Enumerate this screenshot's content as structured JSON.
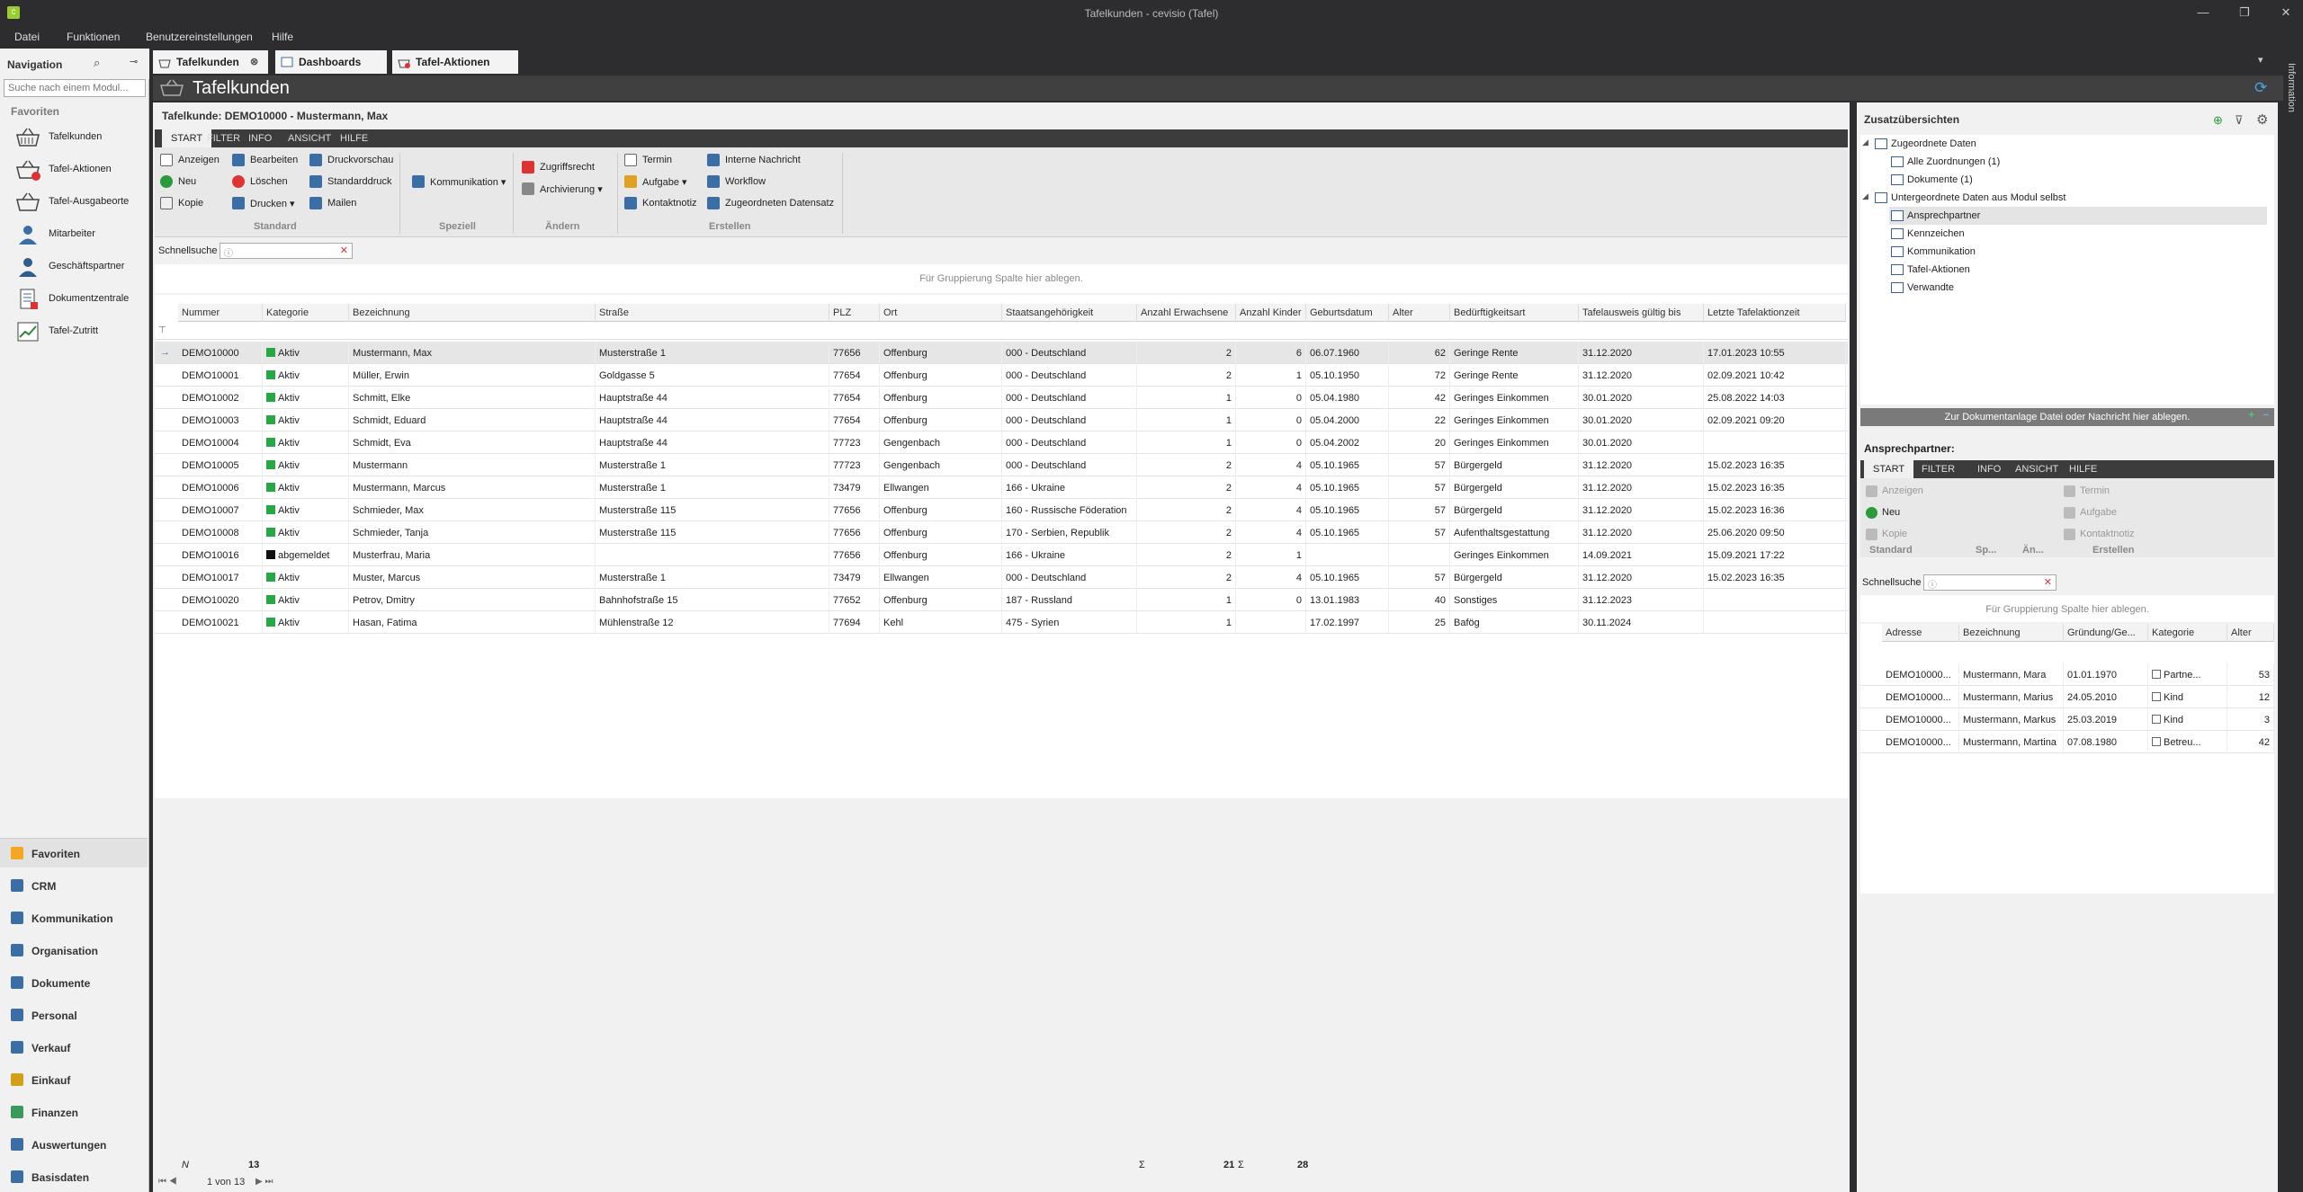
{
  "window": {
    "title": "Tafelkunden - cevisio (Tafel)"
  },
  "menu": [
    "Datei",
    "Funktionen",
    "Benutzereinstellungen",
    "Hilfe"
  ],
  "nav": {
    "title": "Navigation",
    "search_placeholder": "Suche nach einem Modul...",
    "favorites_header": "Favoriten",
    "items": [
      {
        "label": "Tafelkunden",
        "icon": "basket-icon"
      },
      {
        "label": "Tafel-Aktionen",
        "icon": "basket-action-icon"
      },
      {
        "label": "Tafel-Ausgabeorte",
        "icon": "basket-location-icon"
      },
      {
        "label": "Mitarbeiter",
        "icon": "employee-icon"
      },
      {
        "label": "Geschäftspartner",
        "icon": "partner-icon"
      },
      {
        "label": "Dokumentzentrale",
        "icon": "document-icon"
      },
      {
        "label": "Tafel-Zutritt",
        "icon": "chart-icon"
      }
    ],
    "categories": [
      {
        "label": "Favoriten",
        "color": "#f5a623"
      },
      {
        "label": "CRM",
        "color": "#3a6ea5"
      },
      {
        "label": "Kommunikation",
        "color": "#3a6ea5"
      },
      {
        "label": "Organisation",
        "color": "#3a6ea5"
      },
      {
        "label": "Dokumente",
        "color": "#3a6ea5"
      },
      {
        "label": "Personal",
        "color": "#3a6ea5"
      },
      {
        "label": "Verkauf",
        "color": "#3a6ea5"
      },
      {
        "label": "Einkauf",
        "color": "#d4a017"
      },
      {
        "label": "Finanzen",
        "color": "#3a9a5a"
      },
      {
        "label": "Auswertungen",
        "color": "#3a6ea5"
      },
      {
        "label": "Basisdaten",
        "color": "#3a6ea5"
      }
    ]
  },
  "doc_tabs": [
    "Tafelkunden",
    "Dashboards",
    "Tafel-Aktionen"
  ],
  "page": {
    "heading": "Tafelkunden",
    "record_title": "Tafelkunde: DEMO10000 - Mustermann, Max"
  },
  "ribbon": {
    "tabs": [
      "START",
      "FILTER",
      "INFO",
      "ANSICHT",
      "HILFE"
    ],
    "buttons": {
      "anzeigen": "Anzeigen",
      "neu": "Neu",
      "kopie": "Kopie",
      "bearbeiten": "Bearbeiten",
      "loeschen": "Löschen",
      "drucken": "Drucken",
      "druckvorschau": "Druckvorschau",
      "standarddruck": "Standarddruck",
      "mailen": "Mailen",
      "kommunikation": "Kommunikation",
      "zugriffsrecht": "Zugriffsrecht",
      "archivierung": "Archivierung",
      "termin": "Termin",
      "aufgabe": "Aufgabe",
      "kontaktnotiz": "Kontaktnotiz",
      "interne_nachricht": "Interne Nachricht",
      "workflow": "Workflow",
      "zugeordneten_datensatz": "Zugeordneten Datensatz"
    },
    "groups": [
      "Standard",
      "Speziell",
      "Ändern",
      "Erstellen"
    ]
  },
  "quicksearch": {
    "label": "Schnellsuche"
  },
  "group_hint": "Für Gruppierung Spalte hier ablegen.",
  "grid": {
    "columns": [
      "Nummer",
      "Kategorie",
      "Bezeichnung",
      "Straße",
      "PLZ",
      "Ort",
      "Staatsangehörigkeit",
      "Anzahl Erwachsene",
      "Anzahl Kinder",
      "Geburtsdatum",
      "Alter",
      "Bedürftigkeitsart",
      "Tafelausweis gültig bis",
      "Letzte Tafelaktionzeit"
    ],
    "rows": [
      [
        "DEMO10000",
        "Aktiv",
        "Mustermann, Max",
        "Musterstraße 1",
        "77656",
        "Offenburg",
        "000 - Deutschland",
        "2",
        "6",
        "06.07.1960",
        "62",
        "Geringe Rente",
        "31.12.2020",
        "17.01.2023 10:55"
      ],
      [
        "DEMO10001",
        "Aktiv",
        "Müller, Erwin",
        "Goldgasse 5",
        "77654",
        "Offenburg",
        "000 - Deutschland",
        "2",
        "1",
        "05.10.1950",
        "72",
        "Geringe Rente",
        "31.12.2020",
        "02.09.2021 10:42"
      ],
      [
        "DEMO10002",
        "Aktiv",
        "Schmitt, Elke",
        "Hauptstraße 44",
        "77654",
        "Offenburg",
        "000 - Deutschland",
        "1",
        "0",
        "05.04.1980",
        "42",
        "Geringes Einkommen",
        "30.01.2020",
        "25.08.2022 14:03"
      ],
      [
        "DEMO10003",
        "Aktiv",
        "Schmidt, Eduard",
        "Hauptstraße 44",
        "77654",
        "Offenburg",
        "000 - Deutschland",
        "1",
        "0",
        "05.04.2000",
        "22",
        "Geringes Einkommen",
        "30.01.2020",
        "02.09.2021 09:20"
      ],
      [
        "DEMO10004",
        "Aktiv",
        "Schmidt, Eva",
        "Hauptstraße 44",
        "77723",
        "Gengenbach",
        "000 - Deutschland",
        "1",
        "0",
        "05.04.2002",
        "20",
        "Geringes Einkommen",
        "30.01.2020",
        ""
      ],
      [
        "DEMO10005",
        "Aktiv",
        "Mustermann",
        "Musterstraße 1",
        "77723",
        "Gengenbach",
        "000 - Deutschland",
        "2",
        "4",
        "05.10.1965",
        "57",
        "Bürgergeld",
        "31.12.2020",
        "15.02.2023 16:35"
      ],
      [
        "DEMO10006",
        "Aktiv",
        "Mustermann, Marcus",
        "Musterstraße 1",
        "73479",
        "Ellwangen",
        "166 - Ukraine",
        "2",
        "4",
        "05.10.1965",
        "57",
        "Bürgergeld",
        "31.12.2020",
        "15.02.2023 16:35"
      ],
      [
        "DEMO10007",
        "Aktiv",
        "Schmieder, Max",
        "Musterstraße 115",
        "77656",
        "Offenburg",
        "160 - Russische Föderation",
        "2",
        "4",
        "05.10.1965",
        "57",
        "Bürgergeld",
        "31.12.2020",
        "15.02.2023 16:36"
      ],
      [
        "DEMO10008",
        "Aktiv",
        "Schmieder, Tanja",
        "Musterstraße 115",
        "77656",
        "Offenburg",
        "170 - Serbien, Republik",
        "2",
        "4",
        "05.10.1965",
        "57",
        "Aufenthaltsgestattung",
        "31.12.2020",
        "25.06.2020 09:50"
      ],
      [
        "DEMO10016",
        "abgemeldet",
        "Musterfrau, Maria",
        "",
        "77656",
        "Offenburg",
        "166 - Ukraine",
        "2",
        "1",
        "",
        "",
        "Geringes Einkommen",
        "14.09.2021",
        "15.09.2021 17:22"
      ],
      [
        "DEMO10017",
        "Aktiv",
        "Muster, Marcus",
        "Musterstraße 1",
        "73479",
        "Ellwangen",
        "000 - Deutschland",
        "2",
        "4",
        "05.10.1965",
        "57",
        "Bürgergeld",
        "31.12.2020",
        "15.02.2023 16:35"
      ],
      [
        "DEMO10020",
        "Aktiv",
        "Petrov, Dmitry",
        "Bahnhofstraße 15",
        "77652",
        "Offenburg",
        "187 - Russland",
        "1",
        "0",
        "13.01.1983",
        "40",
        "Sonstiges",
        "31.12.2023",
        ""
      ],
      [
        "DEMO10021",
        "Aktiv",
        "Hasan, Fatima",
        "Mühlenstraße 12",
        "77694",
        "Kehl",
        "475 - Syrien",
        "1",
        "",
        "17.02.1997",
        "25",
        "Bafög",
        "30.11.2024",
        ""
      ]
    ]
  },
  "summary": {
    "count_label": "N",
    "count": "13",
    "sum_erwachsene": "21",
    "sum_kinder": "28",
    "sigma": "Σ"
  },
  "pager": {
    "text": "1 von 13"
  },
  "right": {
    "title": "Zusatzübersichten",
    "tree": [
      {
        "label": "Zugeordnete Daten",
        "level": 0
      },
      {
        "label": "Alle Zuordnungen (1)",
        "level": 1
      },
      {
        "label": "Dokumente (1)",
        "level": 1
      },
      {
        "label": "Untergeordnete Daten aus Modul selbst",
        "level": 0
      },
      {
        "label": "Ansprechpartner",
        "level": 1
      },
      {
        "label": "Kennzeichen",
        "level": 1
      },
      {
        "label": "Kommunikation",
        "level": 1
      },
      {
        "label": "Tafel-Aktionen",
        "level": 1
      },
      {
        "label": "Verwandte",
        "level": 1
      }
    ],
    "drop_text": "Zur Dokumentanlage Datei oder Nachricht hier ablegen.",
    "ap_title": "Ansprechpartner:",
    "ap_tabs": [
      "START",
      "FILTER",
      "INFO",
      "ANSICHT",
      "HILFE"
    ],
    "ap_buttons": {
      "anzeigen": "Anzeigen",
      "neu": "Neu",
      "kopie": "Kopie",
      "termin": "Termin",
      "aufgabe": "Aufgabe",
      "kontaktnotiz": "Kontaktnotiz"
    },
    "ap_groups": [
      "Standard",
      "Sp...",
      "Än...",
      "Erstellen"
    ],
    "ap_qs_label": "Schnellsuche",
    "ap_hint": "Für Gruppierung Spalte hier ablegen.",
    "ap_columns": [
      "Adresse",
      "Bezeichnung",
      "Gründung/Ge...",
      "Kategorie",
      "Alter"
    ],
    "ap_rows": [
      [
        "DEMO10000...",
        "Mustermann, Mara",
        "01.01.1970",
        "Partne...",
        "53"
      ],
      [
        "DEMO10000...",
        "Mustermann, Marius",
        "24.05.2010",
        "Kind",
        "12"
      ],
      [
        "DEMO10000...",
        "Mustermann, Markus",
        "25.03.2019",
        "Kind",
        "3"
      ],
      [
        "DEMO10000...",
        "Mustermann, Martina",
        "07.08.1980",
        "Betreu...",
        "42"
      ]
    ]
  },
  "info_strip": "Information"
}
